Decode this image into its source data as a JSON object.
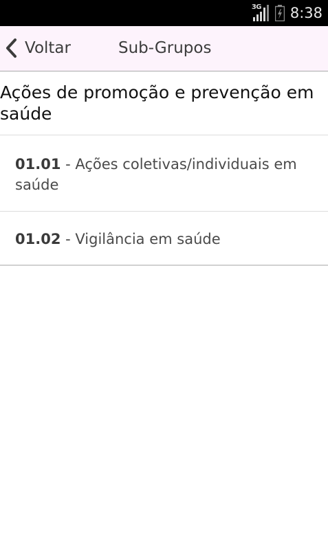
{
  "status_bar": {
    "network_type": "3G",
    "time": "8:38",
    "icons": [
      "signal-icon",
      "battery-charging-icon"
    ]
  },
  "action_bar": {
    "back_label": "Voltar",
    "title": "Sub-Grupos",
    "background_color": "#fdf3fc"
  },
  "group": {
    "title": "Ações de promoção e prevenção em saúde"
  },
  "subgroups": [
    {
      "code": "01.01",
      "separator": " - ",
      "name": "Ações coletivas/individuais em saúde"
    },
    {
      "code": "01.02",
      "separator": " - ",
      "name": "Vigilância em saúde"
    }
  ]
}
